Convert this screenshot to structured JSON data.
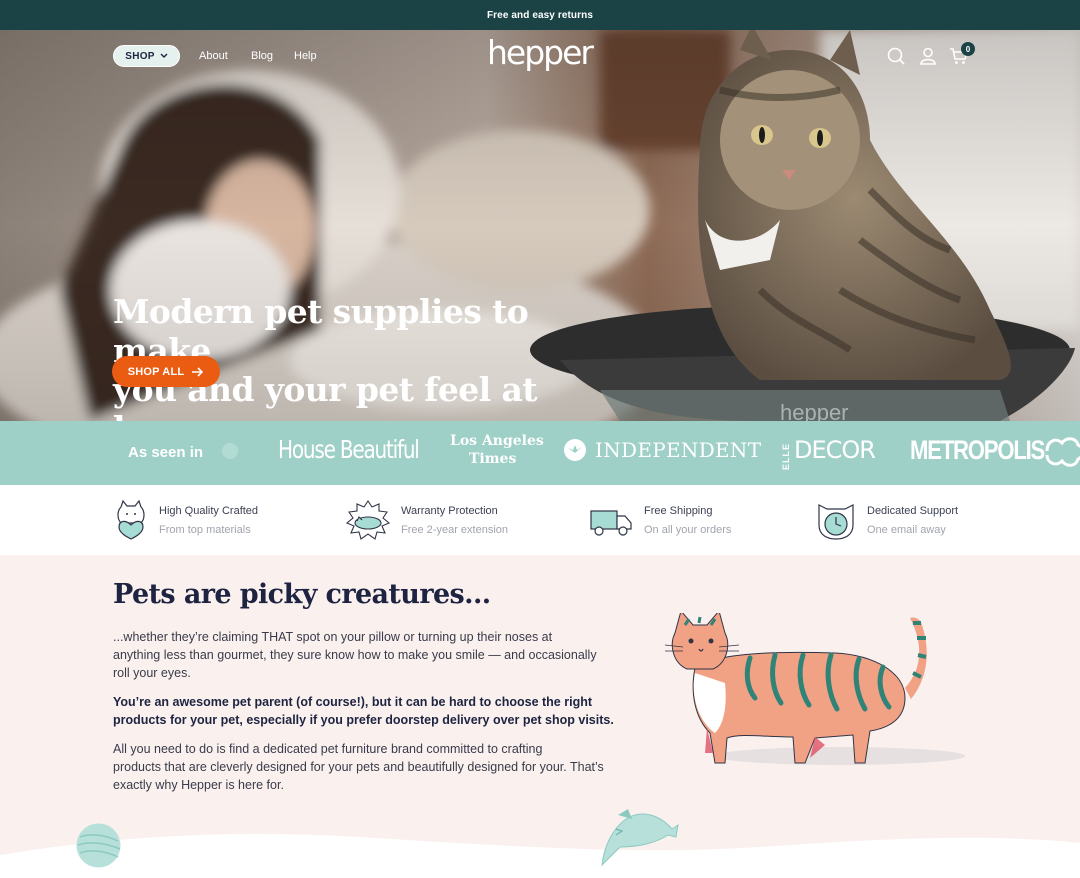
{
  "announcement": "Free and easy returns",
  "nav": {
    "shop_label": "SHOP",
    "links": [
      "About",
      "Blog",
      "Help"
    ],
    "logo_text": "hepper",
    "cart_count": "0"
  },
  "hero": {
    "title_line1": "Modern pet supplies to make",
    "title_line2": "you and your pet feel at home",
    "cta_label": "SHOP ALL"
  },
  "as_seen_in": {
    "label": "As seen in",
    "publications": [
      "House Beautiful",
      "Los Angeles",
      "Times",
      "INDEPENDENT",
      "ELLE",
      "DECOR",
      "METROPOLIS"
    ]
  },
  "features": [
    {
      "title": "High Quality Crafted",
      "subtitle": "From top materials",
      "icon": "crafted-cat-icon"
    },
    {
      "title": "Warranty Protection",
      "subtitle": "Free 2-year extension",
      "icon": "warranty-cat-icon"
    },
    {
      "title": "Free Shipping",
      "subtitle": "On all your orders",
      "icon": "truck-icon"
    },
    {
      "title": "Dedicated Support",
      "subtitle": "One email away",
      "icon": "clock-cat-icon"
    }
  ],
  "content": {
    "title": "Pets are picky creatures...",
    "p1_l1": "...whether they’re claiming THAT spot on your pillow or turning up their noses at",
    "p1_l2": "anything less than gourmet, they sure know how to make you smile — and occasionally",
    "p1_l3": "roll your eyes.",
    "p2_l1": "You’re an awesome pet parent (of course!), but it can be hard to choose the right",
    "p2_l2": "products for your pet, especially if you prefer doorstep delivery over pet shop visits.",
    "p3_l1": "All you need to do is find a dedicated pet furniture brand committed to crafting",
    "p3_l2": "products that are cleverly designed for your pets and beautifully designed for your. That’s",
    "p3_l3": "exactly why Hepper is here for."
  },
  "colors": {
    "announcement_bg": "#1b4346",
    "accent_orange": "#e95c12",
    "teal_band": "#9fd0c8",
    "content_bg": "#faf1ef",
    "navy_text": "#1d2340"
  }
}
